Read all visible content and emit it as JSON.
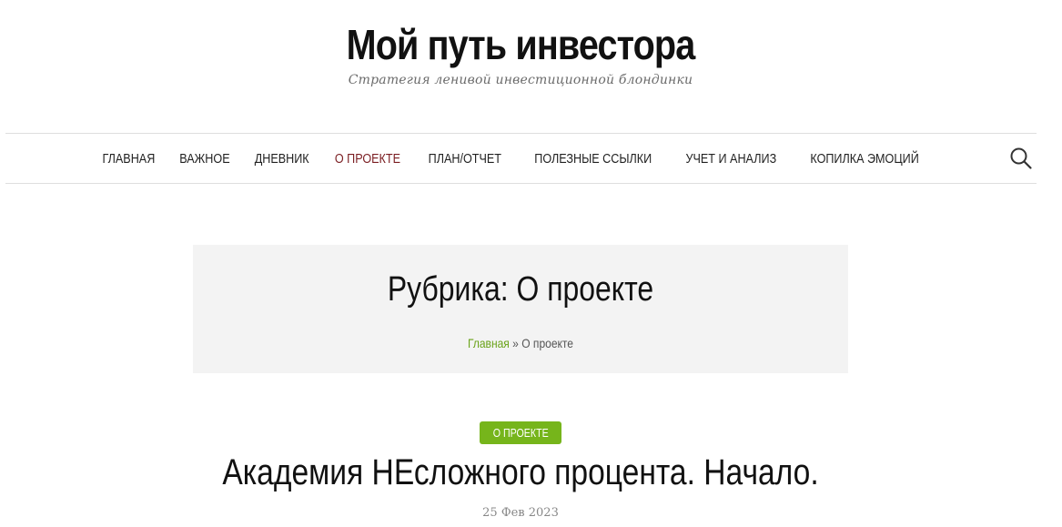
{
  "site": {
    "title": "Мой путь инвестора",
    "tagline": "Стратегия ленивой инвестиционной блондинки"
  },
  "nav": {
    "items": [
      {
        "label": "ГЛАВНАЯ"
      },
      {
        "label": "ВАЖНОЕ"
      },
      {
        "label": "ДНЕВНИК"
      },
      {
        "label": "О ПРОЕКТЕ",
        "active": true
      },
      {
        "label": "ПЛАН/ОТЧЕТ"
      },
      {
        "label": "ПОЛЕЗНЫЕ ССЫЛКИ"
      },
      {
        "label": "УЧЕТ И АНАЛИЗ"
      },
      {
        "label": "КОПИЛКА ЭМОЦИЙ"
      }
    ],
    "search_icon": "search-icon"
  },
  "category": {
    "title": "Рубрика: О проекте",
    "breadcrumb": {
      "home": "Главная",
      "separator": "»",
      "current": "О проекте"
    }
  },
  "post": {
    "category_badge": "О ПРОЕКТЕ",
    "title": "Академия НЕсложного процента. Начало.",
    "date": "25 Фев 2023"
  },
  "colors": {
    "accent_active": "#7b1e22",
    "badge_green": "#76b51b",
    "link_green": "#6aa319",
    "box_bg": "#f3f3f3"
  }
}
